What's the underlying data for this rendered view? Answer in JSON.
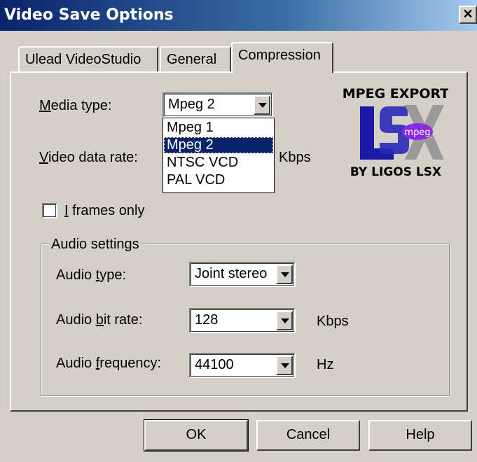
{
  "window": {
    "title": "Video Save Options",
    "close_glyph": "✕"
  },
  "tabs": [
    {
      "label": "Ulead VideoStudio",
      "active": false
    },
    {
      "label": "General",
      "active": false
    },
    {
      "label": "Compression",
      "active": true
    }
  ],
  "media_type": {
    "label_prefix": "M",
    "label_rest": "edia type:",
    "value": "Mpeg 2",
    "options": [
      "Mpeg 1",
      "Mpeg 2",
      "NTSC VCD",
      "PAL VCD"
    ],
    "selected_index": 1
  },
  "video_data_rate": {
    "label_prefix": "V",
    "label_rest": "ideo data rate:",
    "unit": "Kbps"
  },
  "i_frames": {
    "label_prefix": "I",
    "label_rest": " frames only",
    "checked": false
  },
  "audio_settings": {
    "title": "Audio settings",
    "type": {
      "label_a": "Audio ",
      "label_u": "t",
      "label_b": "ype:",
      "value": "Joint stereo"
    },
    "bit_rate": {
      "label_a": "Audio ",
      "label_u": "b",
      "label_b": "it rate:",
      "value": "128",
      "unit": "Kbps"
    },
    "frequency": {
      "label_a": "Audio ",
      "label_u": "f",
      "label_b": "requency:",
      "value": "44100",
      "unit": "Hz"
    }
  },
  "logo": {
    "top_text": "MPEG EXPORT",
    "mid_text": "mpeg",
    "bottom_text": "BY LIGOS LSX",
    "monogram": "LSX"
  },
  "buttons": {
    "ok": "OK",
    "cancel": "Cancel",
    "help": "Help"
  },
  "colors": {
    "face": "#d4d0c8",
    "title_blue": "#0a246a",
    "highlight": "#0a246a"
  }
}
